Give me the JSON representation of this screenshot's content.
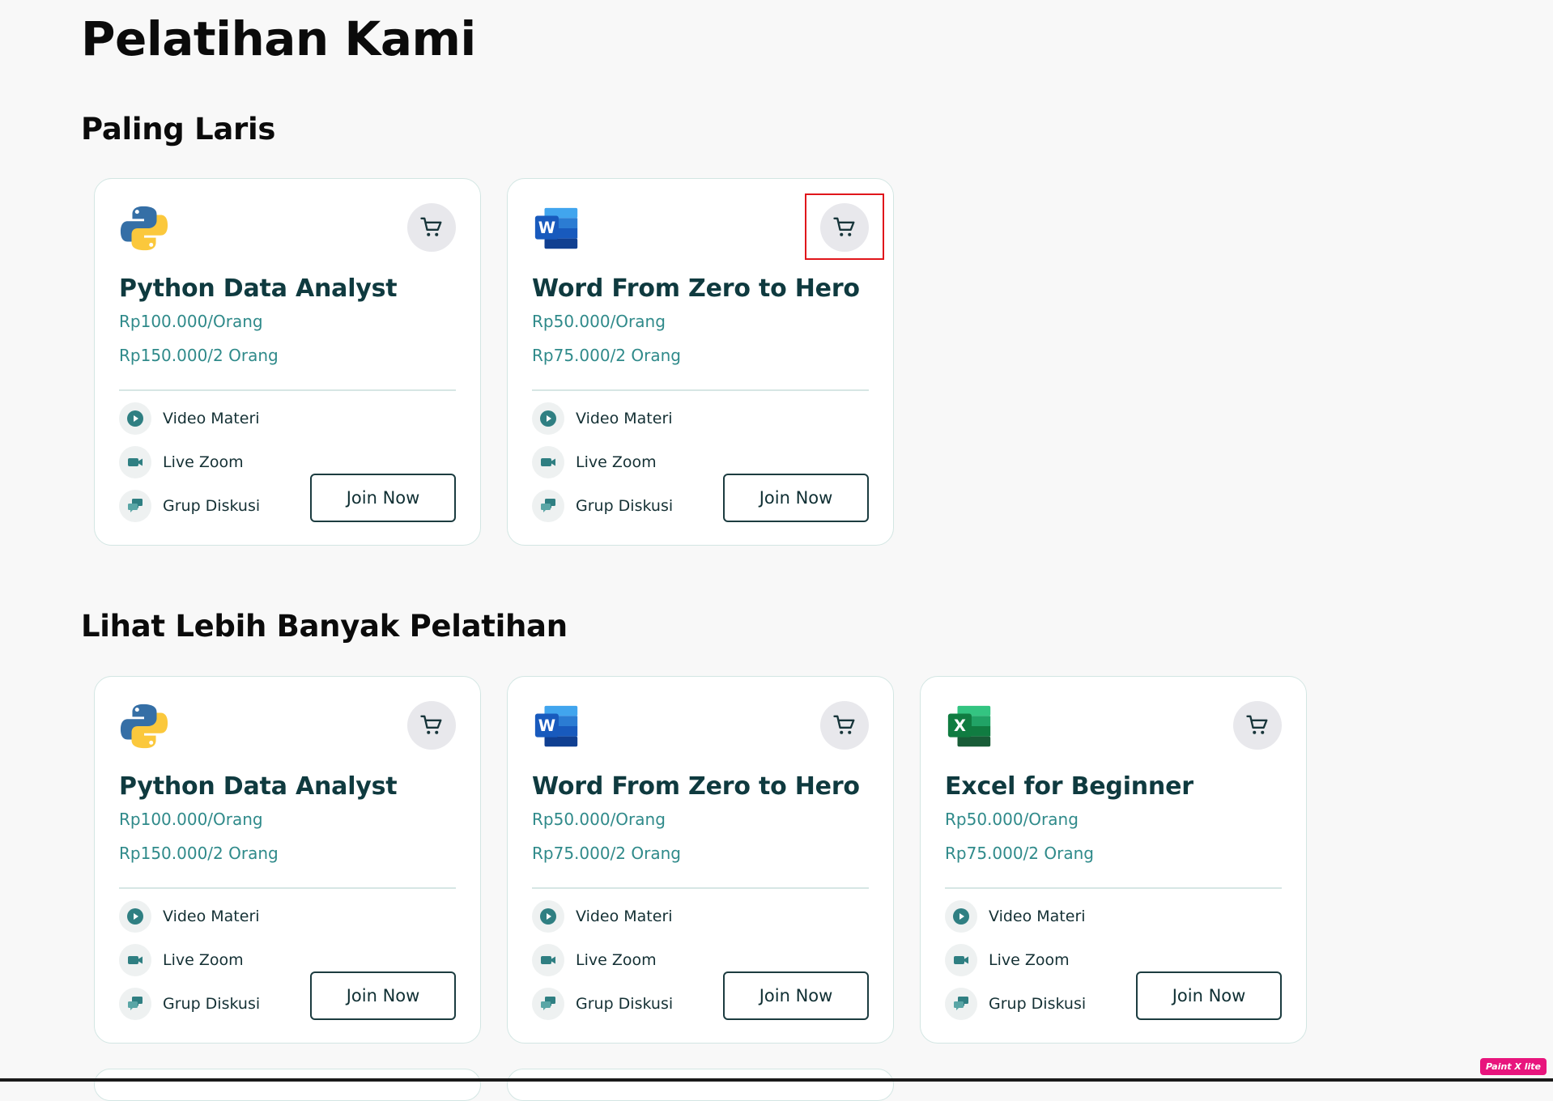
{
  "page": {
    "title": "Pelatihan Kami"
  },
  "sections": [
    {
      "title": "Paling Laris",
      "cards": [
        {
          "logo": "python-logo",
          "title": "Python Data Analyst",
          "price_single": "Rp100.000/Orang",
          "price_pair": "Rp150.000/2 Orang",
          "features": [
            "Video Materi",
            "Live Zoom",
            "Grup Diskusi"
          ],
          "button": "Join Now",
          "cart_icon": "cart-icon",
          "cart_highlighted": false
        },
        {
          "logo": "word-logo",
          "title": "Word From Zero to Hero",
          "price_single": "Rp50.000/Orang",
          "price_pair": "Rp75.000/2 Orang",
          "features": [
            "Video Materi",
            "Live Zoom",
            "Grup Diskusi"
          ],
          "button": "Join Now",
          "cart_icon": "cart-icon",
          "cart_highlighted": true
        }
      ]
    },
    {
      "title": "Lihat Lebih Banyak Pelatihan",
      "cards": [
        {
          "logo": "python-logo",
          "title": "Python Data Analyst",
          "price_single": "Rp100.000/Orang",
          "price_pair": "Rp150.000/2 Orang",
          "features": [
            "Video Materi",
            "Live Zoom",
            "Grup Diskusi"
          ],
          "button": "Join Now",
          "cart_icon": "cart-icon"
        },
        {
          "logo": "word-logo",
          "title": "Word From Zero to Hero",
          "price_single": "Rp50.000/Orang",
          "price_pair": "Rp75.000/2 Orang",
          "features": [
            "Video Materi",
            "Live Zoom",
            "Grup Diskusi"
          ],
          "button": "Join Now",
          "cart_icon": "cart-icon"
        },
        {
          "logo": "excel-logo",
          "title": "Excel for Beginner",
          "price_single": "Rp50.000/Orang",
          "price_pair": "Rp75.000/2 Orang",
          "features": [
            "Video Materi",
            "Live Zoom",
            "Grup Diskusi"
          ],
          "button": "Join Now",
          "cart_icon": "cart-icon"
        }
      ]
    }
  ],
  "feature_icons": [
    "play-icon",
    "video-camera-icon",
    "chat-bubbles-icon"
  ],
  "badge": {
    "text": "Paint X lite"
  },
  "colors": {
    "accent": "#2f8a8a",
    "title": "#0f3a3f",
    "card_border": "#d3e6e3",
    "highlight": "#e0161b",
    "badge": "#e8157d"
  }
}
